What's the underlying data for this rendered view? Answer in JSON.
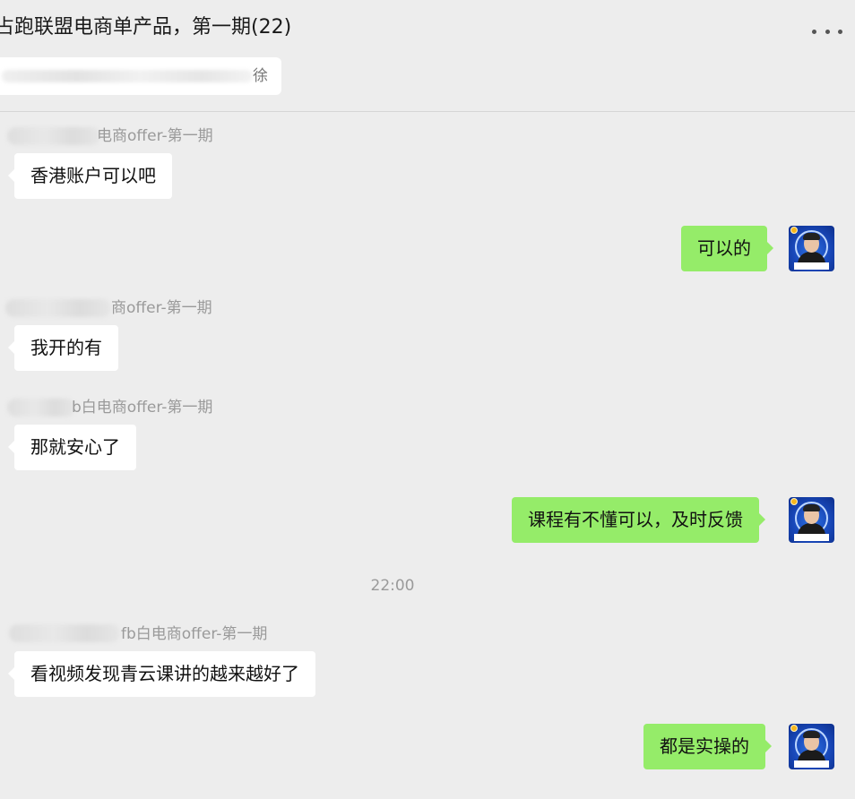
{
  "header": {
    "title": "占跑联盟电商单产品，第一期(22)",
    "more_icon": "more-horizontal-icon",
    "pinned_text_end": "徐"
  },
  "messages": [
    {
      "side": "in",
      "sender": "电商offer-第一期",
      "text": "香港账户可以吧"
    },
    {
      "side": "out",
      "text": "可以的"
    },
    {
      "side": "in",
      "sender": "商offer-第一期",
      "text": "我开的有"
    },
    {
      "side": "in",
      "sender": "b白电商offer-第一期",
      "text": "那就安心了"
    },
    {
      "side": "out",
      "text": "课程有不懂可以，及时反馈"
    },
    {
      "type": "time",
      "text": "22:00"
    },
    {
      "side": "in",
      "sender": "fb白电商offer-第一期",
      "text": "看视频发现青云课讲的越来越好了"
    },
    {
      "side": "out",
      "text": "都是实操的"
    }
  ],
  "colors": {
    "background": "#ededed",
    "incoming_bubble": "#ffffff",
    "outgoing_bubble": "#95ec69",
    "meta_text": "#9a9a9a"
  }
}
